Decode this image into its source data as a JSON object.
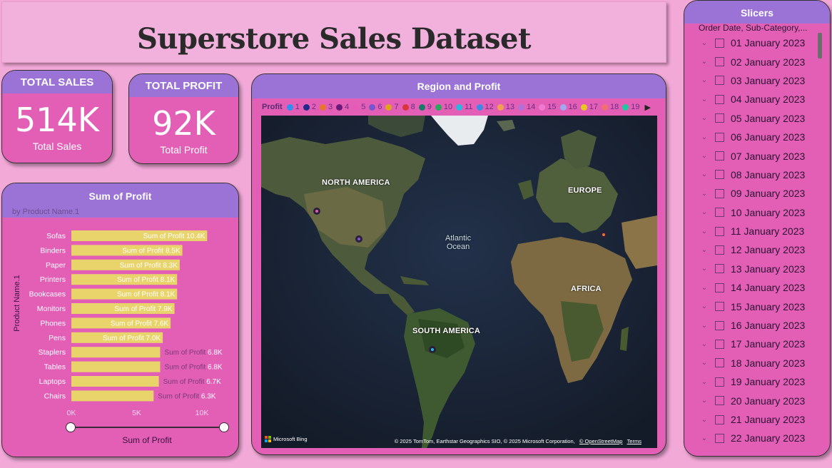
{
  "title": "Superstore Sales Dataset",
  "kpis": {
    "sales": {
      "header": "TOTAL SALES",
      "value": "514K",
      "label": "Total Sales"
    },
    "profit": {
      "header": "TOTAL PROFIT",
      "value": "92K",
      "label": "Total Profit"
    }
  },
  "bar_chart": {
    "title": "Sum of Profit",
    "subtitle": "by Product Name.1",
    "ylabel": "Product Name.1",
    "xlabel": "Sum of Profit",
    "label_prefix": "Sum of Profit",
    "bar_color": "#e8d46a",
    "x_ticks": [
      "0K",
      "5K",
      "10K"
    ]
  },
  "chart_data": {
    "type": "bar",
    "orientation": "horizontal",
    "title": "Sum of Profit",
    "subtitle": "by Product Name.1",
    "xlabel": "Sum of Profit",
    "ylabel": "Product Name.1",
    "xlim": [
      0,
      12000
    ],
    "categories": [
      "Sofas",
      "Binders",
      "Paper",
      "Printers",
      "Bookcases",
      "Monitors",
      "Phones",
      "Pens",
      "Staplers",
      "Tables",
      "Laptops",
      "Chairs"
    ],
    "values": [
      10400,
      8500,
      8300,
      8100,
      8100,
      7900,
      7600,
      7000,
      6800,
      6800,
      6700,
      6300
    ],
    "data_labels": [
      "10.4K",
      "8.5K",
      "8.3K",
      "8.1K",
      "8.1K",
      "7.9K",
      "7.6K",
      "7.0K",
      "6.8K",
      "6.8K",
      "6.7K",
      "6.3K"
    ]
  },
  "map": {
    "title": "Region and Profit",
    "legend_title": "Profit",
    "legend": [
      {
        "label": "1",
        "color": "#2f8ff0"
      },
      {
        "label": "2",
        "color": "#1f2a8a"
      },
      {
        "label": "3",
        "color": "#e8752f"
      },
      {
        "label": "4",
        "color": "#6b1a7a"
      },
      {
        "label": "5",
        "color": "#e85ab8"
      },
      {
        "label": "6",
        "color": "#7a55d0"
      },
      {
        "label": "7",
        "color": "#e0a31a"
      },
      {
        "label": "8",
        "color": "#d8363d"
      },
      {
        "label": "9",
        "color": "#1a7a6a"
      },
      {
        "label": "10",
        "color": "#2aa85a"
      },
      {
        "label": "11",
        "color": "#28b8e0"
      },
      {
        "label": "12",
        "color": "#3a8ae8"
      },
      {
        "label": "13",
        "color": "#f0a050"
      },
      {
        "label": "14",
        "color": "#b070d8"
      },
      {
        "label": "15",
        "color": "#f07ad0"
      },
      {
        "label": "16",
        "color": "#a0a8f0"
      },
      {
        "label": "17",
        "color": "#e8c820"
      },
      {
        "label": "18",
        "color": "#f07070"
      },
      {
        "label": "19",
        "color": "#20c8a0"
      }
    ],
    "labels": {
      "north_america": "NORTH AMERICA",
      "europe": "EUROPE",
      "atlantic": "Atlantic",
      "ocean": "Ocean",
      "africa": "AFRICA",
      "south_america": "SOUTH AMERICA"
    },
    "attribution": "© 2025 TomTom, Earthstar Geographics SIO, © 2025 Microsoft Corporation,",
    "osm_link": "© OpenStreetMap",
    "terms_link": "Terms",
    "bing": "Microsoft Bing"
  },
  "slicer": {
    "title": "Slicers",
    "subtitle": "Order Date, Sub-Category,...",
    "items": [
      "01 January 2023",
      "02 January 2023",
      "03 January 2023",
      "04 January 2023",
      "05 January 2023",
      "06 January 2023",
      "07 January 2023",
      "08 January 2023",
      "09 January 2023",
      "10 January 2023",
      "11 January 2023",
      "12 January 2023",
      "13 January 2023",
      "14 January 2023",
      "15 January 2023",
      "16 January 2023",
      "17 January 2023",
      "18 January 2023",
      "19 January 2023",
      "20 January 2023",
      "21 January 2023",
      "22 January 2023"
    ]
  }
}
